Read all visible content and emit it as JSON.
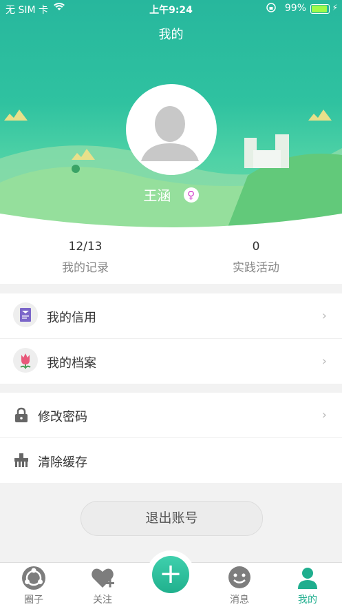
{
  "status_bar": {
    "carrier": "无 SIM 卡",
    "time": "上午9:24",
    "battery": "99%"
  },
  "header": {
    "title": "我的",
    "user_name": "王涵",
    "gender_symbol": "♀"
  },
  "stats": [
    {
      "value": "12/13",
      "label": "我的记录"
    },
    {
      "value": "0",
      "label": "实践活动"
    }
  ],
  "menu_group_1": [
    {
      "label": "我的信用",
      "icon": "credit-card-icon"
    },
    {
      "label": "我的档案",
      "icon": "tulip-icon"
    }
  ],
  "menu_group_2": [
    {
      "label": "修改密码",
      "icon": "lock-icon"
    },
    {
      "label": "清除缓存",
      "icon": "broom-icon"
    }
  ],
  "logout_label": "退出账号",
  "tabbar": {
    "items": [
      {
        "label": "圈子",
        "icon": "circle-group-icon"
      },
      {
        "label": "关注",
        "icon": "heart-plus-icon"
      },
      {
        "label": "消息",
        "icon": "smile-icon"
      },
      {
        "label": "我的",
        "icon": "person-icon"
      }
    ],
    "add_symbol": "+",
    "accent_color": "#1fae8e"
  }
}
